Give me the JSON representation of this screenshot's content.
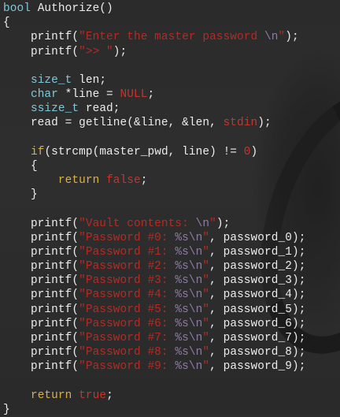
{
  "code_lines": [
    {
      "tokens": [
        {
          "t": "bool",
          "c": "ty"
        },
        {
          "t": " Authorize()",
          "c": "plain"
        }
      ]
    },
    {
      "tokens": [
        {
          "t": "{",
          "c": "plain"
        }
      ]
    },
    {
      "tokens": [
        {
          "t": "    printf(",
          "c": "plain"
        },
        {
          "t": "\"Enter the master password",
          "c": "str"
        },
        {
          "t": " \\n",
          "c": "esc"
        },
        {
          "t": "\"",
          "c": "str"
        },
        {
          "t": ");",
          "c": "plain"
        }
      ]
    },
    {
      "tokens": [
        {
          "t": "    printf(",
          "c": "plain"
        },
        {
          "t": "\">> \"",
          "c": "str"
        },
        {
          "t": ");",
          "c": "plain"
        }
      ]
    },
    {
      "tokens": []
    },
    {
      "tokens": [
        {
          "t": "    ",
          "c": "plain"
        },
        {
          "t": "size_t",
          "c": "ty"
        },
        {
          "t": " len;",
          "c": "plain"
        }
      ]
    },
    {
      "tokens": [
        {
          "t": "    ",
          "c": "plain"
        },
        {
          "t": "char",
          "c": "ty"
        },
        {
          "t": " *line = ",
          "c": "plain"
        },
        {
          "t": "NULL",
          "c": "num"
        },
        {
          "t": ";",
          "c": "plain"
        }
      ]
    },
    {
      "tokens": [
        {
          "t": "    ",
          "c": "plain"
        },
        {
          "t": "ssize_t",
          "c": "ty"
        },
        {
          "t": " read;",
          "c": "plain"
        }
      ]
    },
    {
      "tokens": [
        {
          "t": "    read = getline(&line, &len, ",
          "c": "plain"
        },
        {
          "t": "stdin",
          "c": "num"
        },
        {
          "t": ");",
          "c": "plain"
        }
      ]
    },
    {
      "tokens": []
    },
    {
      "tokens": [
        {
          "t": "    ",
          "c": "plain"
        },
        {
          "t": "if",
          "c": "kw"
        },
        {
          "t": "(strcmp(master_pwd, line) != ",
          "c": "plain"
        },
        {
          "t": "0",
          "c": "num"
        },
        {
          "t": ")",
          "c": "plain"
        }
      ]
    },
    {
      "tokens": [
        {
          "t": "    {",
          "c": "plain"
        }
      ]
    },
    {
      "tokens": [
        {
          "t": "        ",
          "c": "plain"
        },
        {
          "t": "return",
          "c": "kw"
        },
        {
          "t": " ",
          "c": "plain"
        },
        {
          "t": "false",
          "c": "num"
        },
        {
          "t": ";",
          "c": "plain"
        }
      ]
    },
    {
      "tokens": [
        {
          "t": "    }",
          "c": "plain"
        }
      ]
    },
    {
      "tokens": []
    },
    {
      "tokens": [
        {
          "t": "    printf(",
          "c": "plain"
        },
        {
          "t": "\"Vault contents: ",
          "c": "str"
        },
        {
          "t": "\\n",
          "c": "esc"
        },
        {
          "t": "\"",
          "c": "str"
        },
        {
          "t": ");",
          "c": "plain"
        }
      ]
    },
    {
      "tokens": [
        {
          "t": "    printf(",
          "c": "plain"
        },
        {
          "t": "\"Password #0: ",
          "c": "str"
        },
        {
          "t": "%s",
          "c": "esc"
        },
        {
          "t": "\\n",
          "c": "esc"
        },
        {
          "t": "\"",
          "c": "str"
        },
        {
          "t": ", password_0);",
          "c": "plain"
        }
      ]
    },
    {
      "tokens": [
        {
          "t": "    printf(",
          "c": "plain"
        },
        {
          "t": "\"Password #1: ",
          "c": "str"
        },
        {
          "t": "%s",
          "c": "esc"
        },
        {
          "t": "\\n",
          "c": "esc"
        },
        {
          "t": "\"",
          "c": "str"
        },
        {
          "t": ", password_1);",
          "c": "plain"
        }
      ]
    },
    {
      "tokens": [
        {
          "t": "    printf(",
          "c": "plain"
        },
        {
          "t": "\"Password #2: ",
          "c": "str"
        },
        {
          "t": "%s",
          "c": "esc"
        },
        {
          "t": "\\n",
          "c": "esc"
        },
        {
          "t": "\"",
          "c": "str"
        },
        {
          "t": ", password_2);",
          "c": "plain"
        }
      ]
    },
    {
      "tokens": [
        {
          "t": "    printf(",
          "c": "plain"
        },
        {
          "t": "\"Password #3: ",
          "c": "str"
        },
        {
          "t": "%s",
          "c": "esc"
        },
        {
          "t": "\\n",
          "c": "esc"
        },
        {
          "t": "\"",
          "c": "str"
        },
        {
          "t": ", password_3);",
          "c": "plain"
        }
      ]
    },
    {
      "tokens": [
        {
          "t": "    printf(",
          "c": "plain"
        },
        {
          "t": "\"Password #4: ",
          "c": "str"
        },
        {
          "t": "%s",
          "c": "esc"
        },
        {
          "t": "\\n",
          "c": "esc"
        },
        {
          "t": "\"",
          "c": "str"
        },
        {
          "t": ", password_4);",
          "c": "plain"
        }
      ]
    },
    {
      "tokens": [
        {
          "t": "    printf(",
          "c": "plain"
        },
        {
          "t": "\"Password #5: ",
          "c": "str"
        },
        {
          "t": "%s",
          "c": "esc"
        },
        {
          "t": "\\n",
          "c": "esc"
        },
        {
          "t": "\"",
          "c": "str"
        },
        {
          "t": ", password_5);",
          "c": "plain"
        }
      ]
    },
    {
      "tokens": [
        {
          "t": "    printf(",
          "c": "plain"
        },
        {
          "t": "\"Password #6: ",
          "c": "str"
        },
        {
          "t": "%s",
          "c": "esc"
        },
        {
          "t": "\\n",
          "c": "esc"
        },
        {
          "t": "\"",
          "c": "str"
        },
        {
          "t": ", password_6);",
          "c": "plain"
        }
      ]
    },
    {
      "tokens": [
        {
          "t": "    printf(",
          "c": "plain"
        },
        {
          "t": "\"Password #7: ",
          "c": "str"
        },
        {
          "t": "%s",
          "c": "esc"
        },
        {
          "t": "\\n",
          "c": "esc"
        },
        {
          "t": "\"",
          "c": "str"
        },
        {
          "t": ", password_7);",
          "c": "plain"
        }
      ]
    },
    {
      "tokens": [
        {
          "t": "    printf(",
          "c": "plain"
        },
        {
          "t": "\"Password #8: ",
          "c": "str"
        },
        {
          "t": "%s",
          "c": "esc"
        },
        {
          "t": "\\n",
          "c": "esc"
        },
        {
          "t": "\"",
          "c": "str"
        },
        {
          "t": ", password_8);",
          "c": "plain"
        }
      ]
    },
    {
      "tokens": [
        {
          "t": "    printf(",
          "c": "plain"
        },
        {
          "t": "\"Password #9: ",
          "c": "str"
        },
        {
          "t": "%s",
          "c": "esc"
        },
        {
          "t": "\\n",
          "c": "esc"
        },
        {
          "t": "\"",
          "c": "str"
        },
        {
          "t": ", password_9);",
          "c": "plain"
        }
      ]
    },
    {
      "tokens": []
    },
    {
      "tokens": [
        {
          "t": "    ",
          "c": "plain"
        },
        {
          "t": "return",
          "c": "kw"
        },
        {
          "t": " ",
          "c": "plain"
        },
        {
          "t": "true",
          "c": "num"
        },
        {
          "t": ";",
          "c": "plain"
        }
      ]
    },
    {
      "tokens": [
        {
          "t": "}",
          "c": "plain"
        }
      ]
    }
  ],
  "colors": {
    "background": "#2c2c2c",
    "plain_text": "#ececec",
    "type_keyword": "#7fc8d8",
    "control_keyword": "#d9b14a",
    "string_literal": "#b52b24",
    "format_escape": "#8f7aa6",
    "constant": "#c2362e"
  }
}
